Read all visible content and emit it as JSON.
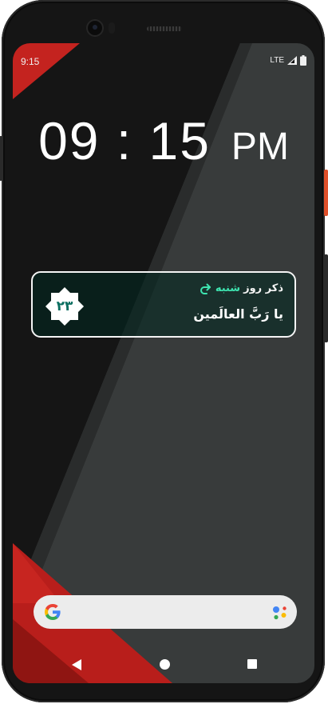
{
  "status": {
    "time": "9:15",
    "network": "LTE",
    "icons": [
      "signal-icon",
      "battery-icon"
    ]
  },
  "clock": {
    "time": "09 : 15",
    "ampm": "PM"
  },
  "widget": {
    "day_number": "۲۳",
    "title_prefix": "ذکر روز",
    "title_day": "شنبه",
    "zikr": "یا رَبَّ العالَمین",
    "accent_color": "#3ee4b0",
    "badge_color": "#0c6f61"
  },
  "search": {
    "logo": "google-icon",
    "assistant": "assistant-icon"
  },
  "nav": {
    "back": "back-icon",
    "home": "home-icon",
    "recents": "recents-icon"
  },
  "colors": {
    "wallpaper_dark": "#151515",
    "wallpaper_grey": "#3a3d3d",
    "wallpaper_red": "#c4231f"
  }
}
